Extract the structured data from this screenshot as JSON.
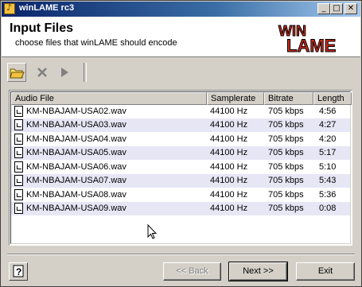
{
  "window": {
    "title": "winLAME rc3"
  },
  "header": {
    "title": "Input Files",
    "subtitle": "choose files that winLAME should encode",
    "logo_text": "WINLAME"
  },
  "toolbar": {
    "icons": [
      "open-folder-icon",
      "delete-icon",
      "play-icon"
    ]
  },
  "list": {
    "columns": [
      "Audio File",
      "Samplerate",
      "Bitrate",
      "Length"
    ],
    "rows": [
      [
        "KM-NBAJAM-USA02.wav",
        "44100 Hz",
        "705 kbps",
        "4:56"
      ],
      [
        "KM-NBAJAM-USA03.wav",
        "44100 Hz",
        "705 kbps",
        "4:27"
      ],
      [
        "KM-NBAJAM-USA04.wav",
        "44100 Hz",
        "705 kbps",
        "4:20"
      ],
      [
        "KM-NBAJAM-USA05.wav",
        "44100 Hz",
        "705 kbps",
        "5:17"
      ],
      [
        "KM-NBAJAM-USA06.wav",
        "44100 Hz",
        "705 kbps",
        "5:10"
      ],
      [
        "KM-NBAJAM-USA07.wav",
        "44100 Hz",
        "705 kbps",
        "5:43"
      ],
      [
        "KM-NBAJAM-USA08.wav",
        "44100 Hz",
        "705 kbps",
        "5:36"
      ],
      [
        "KM-NBAJAM-USA09.wav",
        "44100 Hz",
        "705 kbps",
        "0:08"
      ]
    ]
  },
  "buttons": {
    "help": "?",
    "back": "<< Back",
    "next": "Next >>",
    "exit": "Exit"
  },
  "colors": {
    "title_start": "#0a246a",
    "title_end": "#a6caf0",
    "row_alt": "#e6e6f5",
    "logo_red": "#cc2a1a"
  }
}
